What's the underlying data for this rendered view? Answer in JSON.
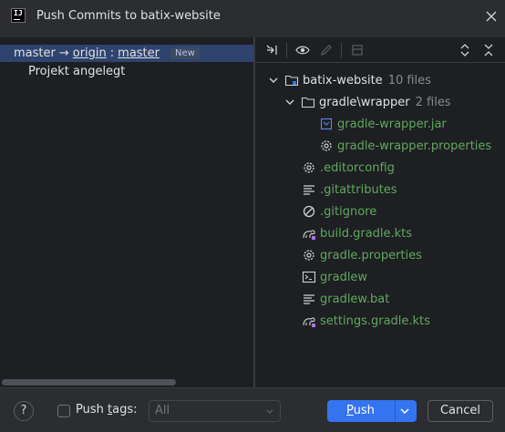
{
  "window": {
    "title": "Push Commits to batix-website",
    "app_icon_text": "IJ"
  },
  "branches": {
    "local": "master",
    "arrow": "→",
    "remote": "origin",
    "separator": ":",
    "remote_branch": "master",
    "badge": "New",
    "commits": [
      "Projekt angelegt"
    ]
  },
  "tree": {
    "root": {
      "name": "batix-website",
      "count": "10 files"
    },
    "folder": {
      "name": "gradle\\wrapper",
      "count": "2 files"
    },
    "nested_files": [
      {
        "name": "gradle-wrapper.jar",
        "icon": "jar-icon"
      },
      {
        "name": "gradle-wrapper.properties",
        "icon": "gear-icon"
      }
    ],
    "files": [
      {
        "name": ".editorconfig",
        "icon": "gear-icon"
      },
      {
        "name": ".gitattributes",
        "icon": "text-lines-icon"
      },
      {
        "name": ".gitignore",
        "icon": "ignore-icon"
      },
      {
        "name": "build.gradle.kts",
        "icon": "gradle-icon"
      },
      {
        "name": "gradle.properties",
        "icon": "gear-icon"
      },
      {
        "name": "gradlew",
        "icon": "terminal-icon"
      },
      {
        "name": "gradlew.bat",
        "icon": "text-lines-icon"
      },
      {
        "name": "settings.gradle.kts",
        "icon": "gradle-icon"
      }
    ]
  },
  "footer": {
    "help": "?",
    "push_tags_label_pre": "Push ",
    "push_tags_mnemonic": "t",
    "push_tags_label_post": "ags:",
    "tags_value": "All",
    "push_mnemonic": "P",
    "push_label_rest": "ush",
    "cancel_label": "Cancel"
  },
  "colors": {
    "accent": "#3574f0",
    "selection": "#2e436e",
    "file_added": "#5fa85f"
  }
}
